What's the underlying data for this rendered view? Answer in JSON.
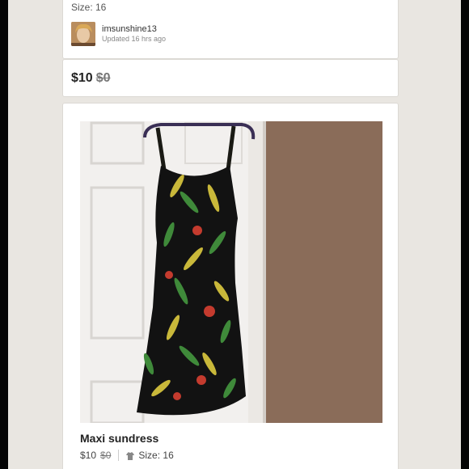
{
  "top_listing": {
    "size_label": "Size: 16",
    "seller_name": "imsunshine13",
    "updated_text": "Updated 16 hrs ago"
  },
  "price_card": {
    "price": "$10",
    "original_price": "$0"
  },
  "listing": {
    "title": "Maxi sundress",
    "price": "$10",
    "original_price": "$0",
    "size_label": "Size: 16",
    "photo_icon": "listing-photo",
    "size_icon": "shirt-icon"
  },
  "colors": {
    "background": "#e9e6e1",
    "card": "#ffffff",
    "text": "#222222"
  }
}
